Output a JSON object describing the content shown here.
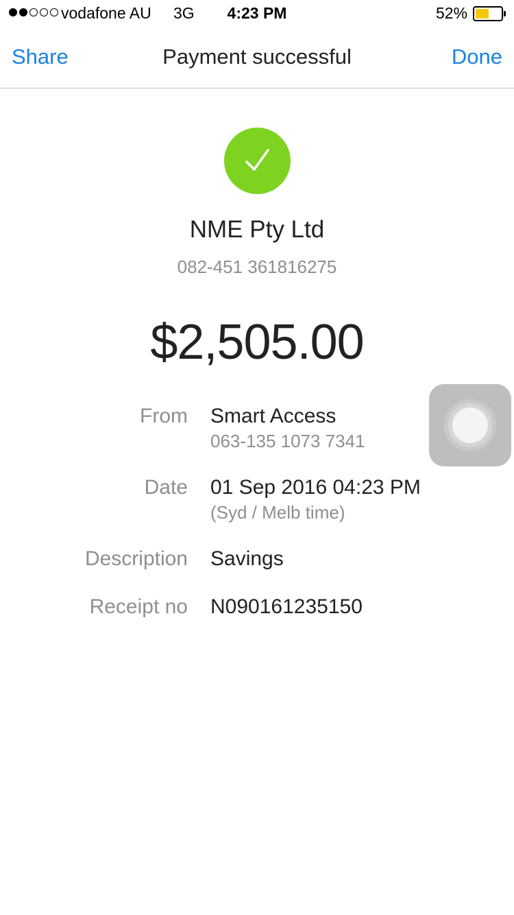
{
  "status_bar": {
    "carrier": "vodafone AU",
    "network": "3G",
    "time": "4:23 PM",
    "battery_percent": "52%",
    "battery_level": 0.52,
    "signal_strength": 2
  },
  "nav": {
    "left_label": "Share",
    "title": "Payment successful",
    "right_label": "Done"
  },
  "payee": {
    "name": "NME Pty Ltd",
    "account": "082-451 361816275"
  },
  "amount": "$2,505.00",
  "details": {
    "from_label": "From",
    "from_value": "Smart Access",
    "from_account": "063-135 1073 7341",
    "date_label": "Date",
    "date_value": "01 Sep 2016 04:23 PM",
    "date_note": "(Syd / Melb time)",
    "description_label": "Description",
    "description_value": "Savings",
    "receipt_label": "Receipt no",
    "receipt_value": "N090161235150"
  },
  "icons": {
    "success": "checkmark-icon",
    "assistive_touch": "assistive-touch-icon"
  },
  "colors": {
    "accent": "#1a82e2",
    "success": "#7ed321",
    "battery": "#f6c800"
  }
}
